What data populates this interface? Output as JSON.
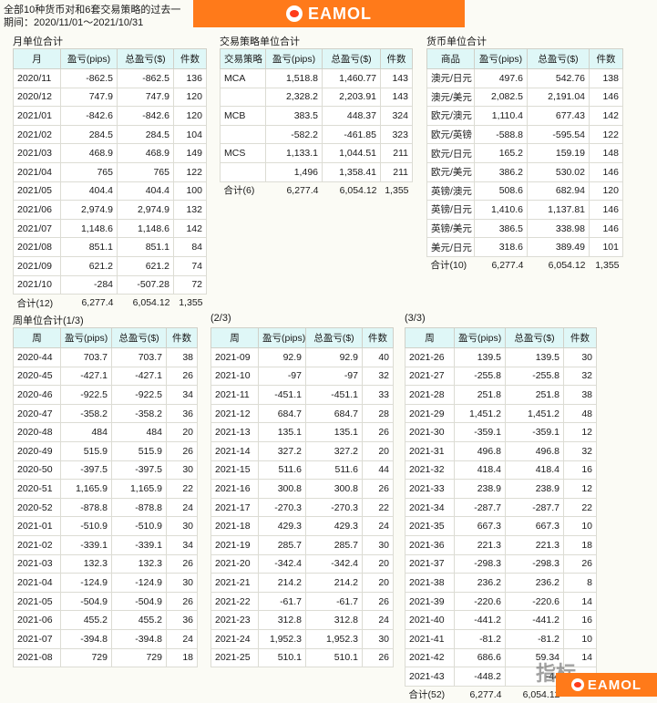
{
  "header": {
    "line1": "全部10种货币对和6套交易策略的过去一",
    "line2": "期间：2020/11/01～2021/10/31",
    "brand": "EAMOL"
  },
  "monthly": {
    "title": "月单位合计",
    "columns": [
      "月",
      "盈亏(pips)",
      "总盈亏($)",
      "件数"
    ],
    "rows": [
      [
        "2020/11",
        "-862.5",
        "-862.5",
        "136"
      ],
      [
        "2020/12",
        "747.9",
        "747.9",
        "120"
      ],
      [
        "2021/01",
        "-842.6",
        "-842.6",
        "120"
      ],
      [
        "2021/02",
        "284.5",
        "284.5",
        "104"
      ],
      [
        "2021/03",
        "468.9",
        "468.9",
        "149"
      ],
      [
        "2021/04",
        "765",
        "765",
        "122"
      ],
      [
        "2021/05",
        "404.4",
        "404.4",
        "100"
      ],
      [
        "2021/06",
        "2,974.9",
        "2,974.9",
        "132"
      ],
      [
        "2021/07",
        "1,148.6",
        "1,148.6",
        "142"
      ],
      [
        "2021/08",
        "851.1",
        "851.1",
        "84"
      ],
      [
        "2021/09",
        "621.2",
        "621.2",
        "74"
      ],
      [
        "2021/10",
        "-284",
        "-507.28",
        "72"
      ]
    ],
    "total": [
      "合计(12)",
      "6,277.4",
      "6,054.12",
      "1,355"
    ]
  },
  "strategy": {
    "title": "交易策略单位合计",
    "columns": [
      "交易策略",
      "盈亏(pips)",
      "总盈亏($)",
      "件数"
    ],
    "rows": [
      [
        "MCA",
        "1,518.8",
        "1,460.77",
        "143"
      ],
      [
        "",
        "2,328.2",
        "2,203.91",
        "143"
      ],
      [
        "MCB",
        "383.5",
        "448.37",
        "324"
      ],
      [
        "",
        "-582.2",
        "-461.85",
        "323"
      ],
      [
        "MCS",
        "1,133.1",
        "1,044.51",
        "211"
      ],
      [
        "",
        "1,496",
        "1,358.41",
        "211"
      ]
    ],
    "total": [
      "合计(6)",
      "6,277.4",
      "6,054.12",
      "1,355"
    ]
  },
  "currency": {
    "title": "货币单位合计",
    "columns": [
      "商品",
      "盈亏(pips)",
      "总盈亏($)",
      "件数"
    ],
    "rows": [
      [
        "澳元/日元",
        "497.6",
        "542.76",
        "138"
      ],
      [
        "澳元/美元",
        "2,082.5",
        "2,191.04",
        "146"
      ],
      [
        "欧元/澳元",
        "1,110.4",
        "677.43",
        "142"
      ],
      [
        "欧元/英镑",
        "-588.8",
        "-595.54",
        "122"
      ],
      [
        "欧元/日元",
        "165.2",
        "159.19",
        "148"
      ],
      [
        "欧元/美元",
        "386.2",
        "530.02",
        "146"
      ],
      [
        "英镑/澳元",
        "508.6",
        "682.94",
        "120"
      ],
      [
        "英镑/日元",
        "1,410.6",
        "1,137.81",
        "146"
      ],
      [
        "英镑/美元",
        "386.5",
        "338.98",
        "146"
      ],
      [
        "美元/日元",
        "318.6",
        "389.49",
        "101"
      ]
    ],
    "total": [
      "合计(10)",
      "6,277.4",
      "6,054.12",
      "1,355"
    ]
  },
  "weekly1": {
    "title": "周单位合计(1/3)",
    "columns": [
      "周",
      "盈亏(pips)",
      "总盈亏($)",
      "件数"
    ],
    "rows": [
      [
        "2020-44",
        "703.7",
        "703.7",
        "38"
      ],
      [
        "2020-45",
        "-427.1",
        "-427.1",
        "26"
      ],
      [
        "2020-46",
        "-922.5",
        "-922.5",
        "34"
      ],
      [
        "2020-47",
        "-358.2",
        "-358.2",
        "36"
      ],
      [
        "2020-48",
        "484",
        "484",
        "20"
      ],
      [
        "2020-49",
        "515.9",
        "515.9",
        "26"
      ],
      [
        "2020-50",
        "-397.5",
        "-397.5",
        "30"
      ],
      [
        "2020-51",
        "1,165.9",
        "1,165.9",
        "22"
      ],
      [
        "2020-52",
        "-878.8",
        "-878.8",
        "24"
      ],
      [
        "2021-01",
        "-510.9",
        "-510.9",
        "30"
      ],
      [
        "2021-02",
        "-339.1",
        "-339.1",
        "34"
      ],
      [
        "2021-03",
        "132.3",
        "132.3",
        "26"
      ],
      [
        "2021-04",
        "-124.9",
        "-124.9",
        "30"
      ],
      [
        "2021-05",
        "-504.9",
        "-504.9",
        "26"
      ],
      [
        "2021-06",
        "455.2",
        "455.2",
        "36"
      ],
      [
        "2021-07",
        "-394.8",
        "-394.8",
        "24"
      ],
      [
        "2021-08",
        "729",
        "729",
        "18"
      ]
    ]
  },
  "weekly2": {
    "title": "(2/3)",
    "columns": [
      "周",
      "盈亏(pips)",
      "总盈亏($)",
      "件数"
    ],
    "rows": [
      [
        "2021-09",
        "92.9",
        "92.9",
        "40"
      ],
      [
        "2021-10",
        "-97",
        "-97",
        "32"
      ],
      [
        "2021-11",
        "-451.1",
        "-451.1",
        "33"
      ],
      [
        "2021-12",
        "684.7",
        "684.7",
        "28"
      ],
      [
        "2021-13",
        "135.1",
        "135.1",
        "26"
      ],
      [
        "2021-14",
        "327.2",
        "327.2",
        "20"
      ],
      [
        "2021-15",
        "511.6",
        "511.6",
        "44"
      ],
      [
        "2021-16",
        "300.8",
        "300.8",
        "26"
      ],
      [
        "2021-17",
        "-270.3",
        "-270.3",
        "22"
      ],
      [
        "2021-18",
        "429.3",
        "429.3",
        "24"
      ],
      [
        "2021-19",
        "285.7",
        "285.7",
        "30"
      ],
      [
        "2021-20",
        "-342.4",
        "-342.4",
        "20"
      ],
      [
        "2021-21",
        "214.2",
        "214.2",
        "20"
      ],
      [
        "2021-22",
        "-61.7",
        "-61.7",
        "26"
      ],
      [
        "2021-23",
        "312.8",
        "312.8",
        "24"
      ],
      [
        "2021-24",
        "1,952.3",
        "1,952.3",
        "30"
      ],
      [
        "2021-25",
        "510.1",
        "510.1",
        "26"
      ]
    ]
  },
  "weekly3": {
    "title": "(3/3)",
    "columns": [
      "周",
      "盈亏(pips)",
      "总盈亏($)",
      "件数"
    ],
    "rows": [
      [
        "2021-26",
        "139.5",
        "139.5",
        "30"
      ],
      [
        "2021-27",
        "-255.8",
        "-255.8",
        "32"
      ],
      [
        "2021-28",
        "251.8",
        "251.8",
        "38"
      ],
      [
        "2021-29",
        "1,451.2",
        "1,451.2",
        "48"
      ],
      [
        "2021-30",
        "-359.1",
        "-359.1",
        "12"
      ],
      [
        "2021-31",
        "496.8",
        "496.8",
        "32"
      ],
      [
        "2021-32",
        "418.4",
        "418.4",
        "16"
      ],
      [
        "2021-33",
        "238.9",
        "238.9",
        "12"
      ],
      [
        "2021-34",
        "-287.7",
        "-287.7",
        "22"
      ],
      [
        "2021-35",
        "667.3",
        "667.3",
        "10"
      ],
      [
        "2021-36",
        "221.3",
        "221.3",
        "18"
      ],
      [
        "2021-37",
        "-298.3",
        "-298.3",
        "26"
      ],
      [
        "2021-38",
        "236.2",
        "236.2",
        "8"
      ],
      [
        "2021-39",
        "-220.6",
        "-220.6",
        "14"
      ],
      [
        "2021-40",
        "-441.2",
        "-441.2",
        "16"
      ],
      [
        "2021-41",
        "-81.2",
        "-81.2",
        "10"
      ],
      [
        "2021-42",
        "686.6",
        "59.34",
        "14"
      ],
      [
        "2021-43",
        "-448.2",
        "-44",
        ""
      ]
    ],
    "total": [
      "合计(52)",
      "6,277.4",
      "6,054.12",
      ""
    ]
  },
  "watermark": {
    "cn": "指标",
    "brand": "EAMOL"
  }
}
